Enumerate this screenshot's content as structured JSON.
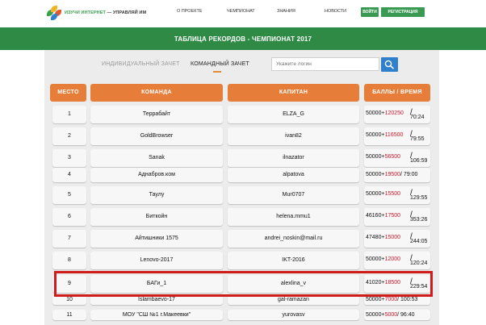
{
  "header": {
    "logo_text_1": "ИЗУЧИ ИНТЕРНЕТ",
    "logo_text_2": "— УПРАВЛЯЙ ИМ",
    "nav": [
      "О ПРОЕКТЕ",
      "ЧЕМПИОНАТ",
      "ЗНАНИЯ",
      "НОВОСТИ"
    ],
    "login_label": "ВОЙТИ",
    "register_label": "РЕГИСТРАЦИЯ"
  },
  "banner": {
    "title": "ТАБЛИЦА РЕКОРДОВ - ЧЕМПИОНАТ 2017"
  },
  "tabs": {
    "individual": "ИНДИВИДУАЛЬНЫЙ ЗАЧЕТ",
    "team": "КОМАНДНЫЙ ЗАЧЕТ"
  },
  "search": {
    "placeholder": "Укажите логин"
  },
  "table": {
    "headers": {
      "place": "МЕСТО",
      "team": "КОМАНДА",
      "captain": "КАПИТАН",
      "score": "БАЛЛЫ / ВРЕМЯ"
    },
    "rows": [
      {
        "place": "1",
        "team": "Террабайт",
        "captain": "ELZA_G",
        "base": "50000+",
        "bonus": "120250",
        "time": "70:24"
      },
      {
        "place": "2",
        "team": "GoldBrowser",
        "captain": "ivan82",
        "base": "50000+",
        "bonus": "116500",
        "time": "79:55"
      },
      {
        "place": "3",
        "team": "Sanak",
        "captain": "ilnazator",
        "base": "50000+",
        "bonus": "56500",
        "time": "106:59"
      },
      {
        "place": "4",
        "team": "Аднабров.ком",
        "captain": "alpatova",
        "base": "50000+",
        "bonus": "19500",
        "time": "79:00"
      },
      {
        "place": "5",
        "team": "Таулу",
        "captain": "Mur0707",
        "base": "50000+",
        "bonus": "15500",
        "time": "129:55"
      },
      {
        "place": "6",
        "team": "Биткойн",
        "captain": "helena.mmu1",
        "base": "46160+",
        "bonus": "17500",
        "time": "353:26"
      },
      {
        "place": "7",
        "team": "Айтишники 1575",
        "captain": "andrei_noskin@mail.ru",
        "base": "47480+",
        "bonus": "15000",
        "time": "244:05"
      },
      {
        "place": "8",
        "team": "Lenovo-2017",
        "captain": "IKT-2016",
        "base": "50000+",
        "bonus": "12000",
        "time": "120:24"
      },
      {
        "place": "9",
        "team": "БАГи_1",
        "captain": "alexlina_v",
        "base": "41020+",
        "bonus": "18500",
        "time": "229:54"
      },
      {
        "place": "10",
        "team": "Islambaevo-17",
        "captain": "gal-ramazan",
        "base": "50000+",
        "bonus": "7000",
        "time": "100:53"
      },
      {
        "place": "11",
        "team": "МОУ \"СШ №1 г.Макеевки\"",
        "captain": "yurovasv",
        "base": "50000+",
        "bonus": "5000",
        "time": "96:40"
      }
    ]
  }
}
